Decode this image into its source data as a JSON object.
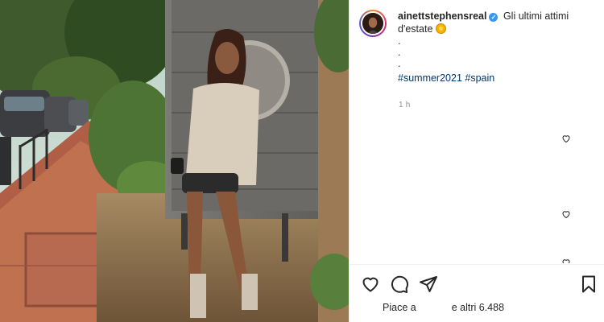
{
  "post": {
    "username": "ainettstephensreal",
    "caption_text": "Gli ultimi attimi d'estate",
    "caption_emoji": "sun-emoji",
    "caption_dots": [
      ".",
      ".",
      "."
    ],
    "hashtags": [
      "#summer2021",
      "#spain"
    ],
    "time_ago": "1 h",
    "verified": true
  },
  "likes": {
    "prefix": "Piace a",
    "suffix": "e altri 6.488"
  },
  "actions": {
    "like_icon": "heart-outline-icon",
    "comment_icon": "comment-bubble-icon",
    "share_icon": "paper-plane-icon",
    "save_icon": "bookmark-icon"
  },
  "colors": {
    "text": "#262626",
    "secondary": "#8e8e8e",
    "link": "#00376b",
    "verified": "#3897f0",
    "divider": "#efefef"
  }
}
